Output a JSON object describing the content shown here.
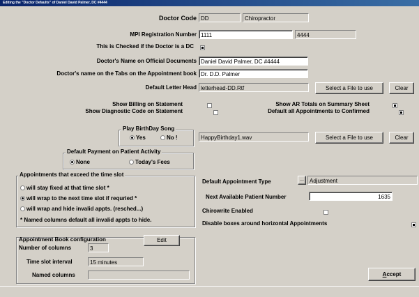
{
  "window": {
    "title": "Editing the \"Doctor Defaults\" of Daniel David Palmer, DC #4444"
  },
  "doctor_code": {
    "label": "Doctor Code",
    "value": "DD",
    "specialty": "Chiropractor"
  },
  "mpi": {
    "label": "MPI Registration Number",
    "value": "1111",
    "extra": "4444"
  },
  "is_dc": {
    "label": "This is Checked if the Doctor is a DC",
    "checked": true
  },
  "official_name": {
    "label": "Doctor's Name on Official Documents",
    "value": "Daniel David Palmer, DC #4444"
  },
  "tab_name": {
    "label": "Doctor's name on the Tabs on the Appointment book",
    "value": "Dr. D.D. Palmer"
  },
  "letterhead": {
    "label": "Default Letter Head",
    "value": "letterhead-DD.Rtf",
    "select_label": "Select a File to use",
    "clear_label": "Clear"
  },
  "statement": {
    "show_billing": "Show Billing on Statement",
    "show_billing_checked": false,
    "show_diag": "Show Diagnostic Code on Statement",
    "show_diag_checked": false,
    "show_ar": "Show AR Totals on Summary Sheet",
    "show_ar_checked": true,
    "default_confirmed": "Default all Appointments to Confirmed",
    "default_confirmed_checked": true
  },
  "birthday": {
    "title": "Play BirthDay Song",
    "yes": "Yes",
    "no": "No !",
    "selected": "yes",
    "file": "HappyBirthday1.wav",
    "select_label": "Select a File to use",
    "clear_label": "Clear"
  },
  "payment": {
    "title": "Default Payment on Patient Activity",
    "none": "None",
    "today": "Today's Fees",
    "selected": "none"
  },
  "timeslot": {
    "title": "Appointments that exceed the time slot",
    "opt1": "will stay fixed at that time slot *",
    "opt2": "will wrap to the next time slot if requried *",
    "opt3": "will wrap and hide invalid appts. (resched...)",
    "selected": "opt2",
    "note": "* Named columns default all invalid appts to hide."
  },
  "appt_type": {
    "label": "Default Appointment Type",
    "button": "...",
    "value": "Adjustment"
  },
  "next_patient": {
    "label": "Next Available Patient Number",
    "value": "1635"
  },
  "chirowrite": {
    "label": "Chirowrite Enabled",
    "checked": false
  },
  "disable_boxes": {
    "label": "Disable boxes around horizontal Appointments",
    "checked": true
  },
  "apptbook": {
    "title": "Appointment Book configuration",
    "edit_label": "Edit",
    "columns_label": "Number of columns",
    "columns_value": "3",
    "interval_label": "Time slot interval",
    "interval_value": "15 minutes",
    "named_label": "Named columns",
    "named_value": ""
  },
  "accept": {
    "label_prefix": "",
    "label_underlined": "A",
    "label_rest": "ccept"
  }
}
